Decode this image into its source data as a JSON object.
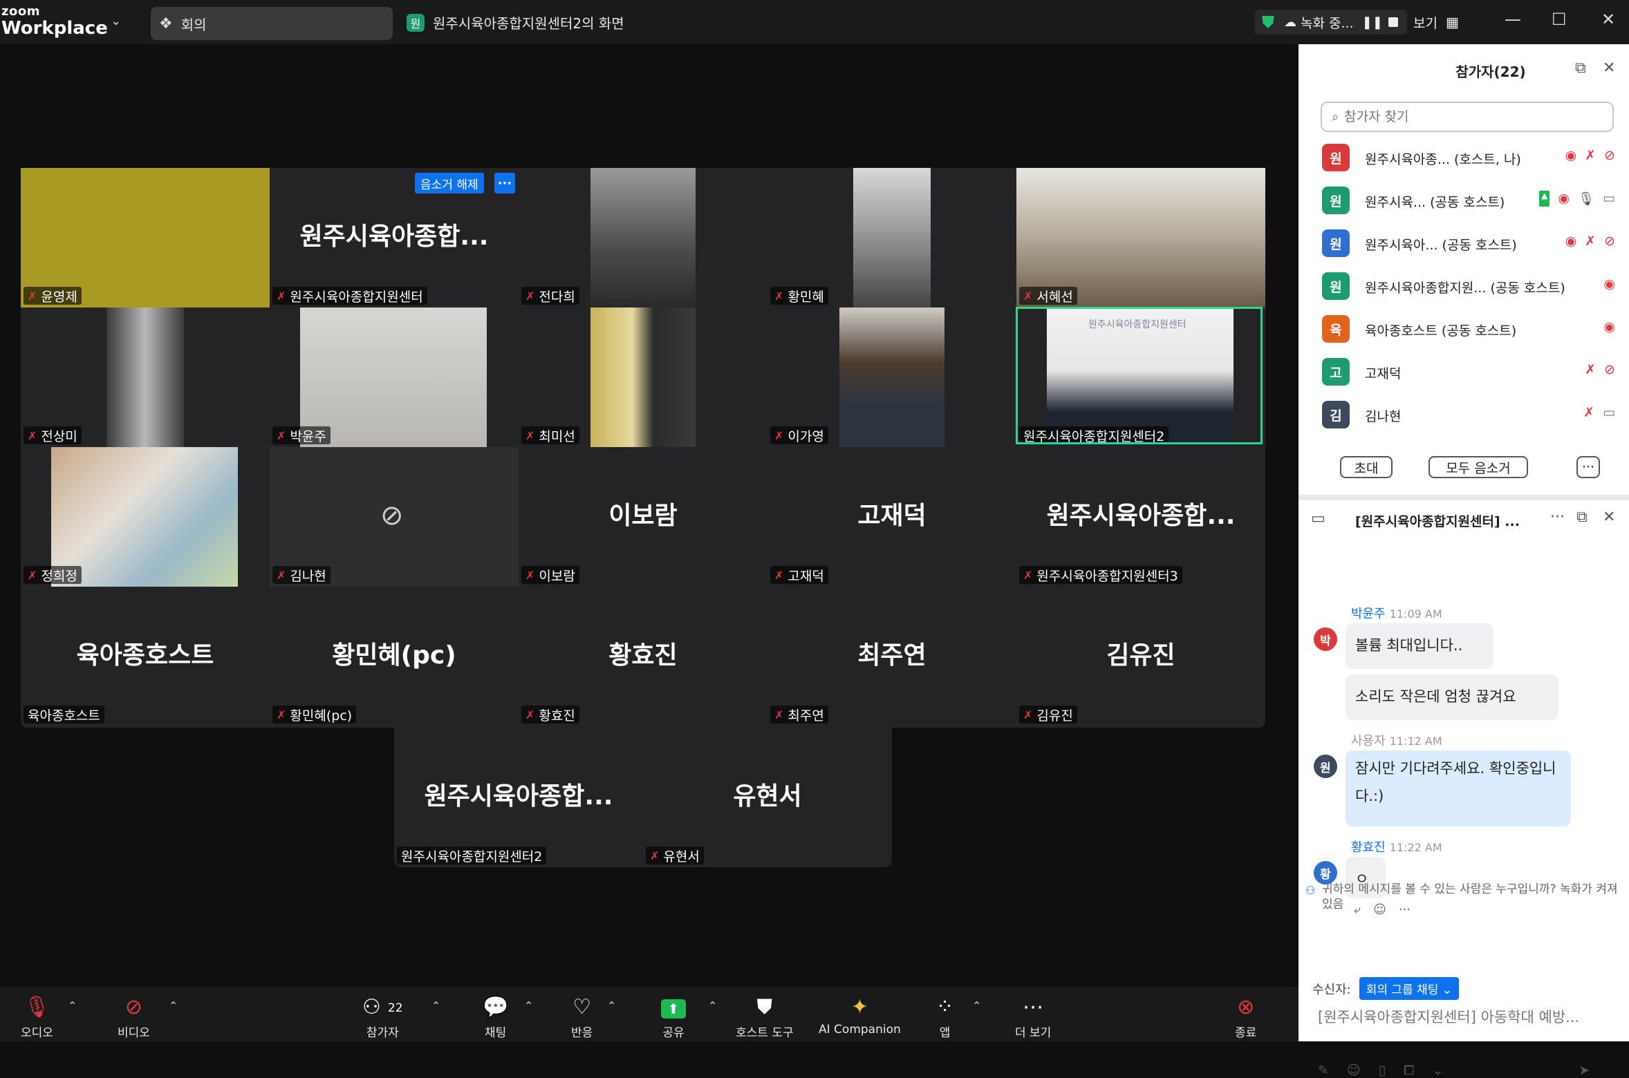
{
  "topbar": {
    "brand_line1": "zoom",
    "brand_line2": "Workplace",
    "meeting_tab": "회의",
    "share_avatar": "원",
    "share_title": "원주시육아종합지원센터2의 화면",
    "recording": "녹화 중...",
    "view": "보기"
  },
  "gallery": {
    "unmute_button": "음소거 해제",
    "more_button": "···",
    "tiles": [
      {
        "name": "윤영제",
        "big": ""
      },
      {
        "name": "원주시육아종합지원센터",
        "big": "원주시육아종합..."
      },
      {
        "name": "전다희",
        "big": ""
      },
      {
        "name": "황민혜",
        "big": ""
      },
      {
        "name": "서혜선",
        "big": ""
      },
      {
        "name": "전상미",
        "big": ""
      },
      {
        "name": "박윤주",
        "big": ""
      },
      {
        "name": "최미선",
        "big": ""
      },
      {
        "name": "이가영",
        "big": ""
      },
      {
        "name": "원주시육아종합지원센터2",
        "big": ""
      },
      {
        "name": "정희정",
        "big": ""
      },
      {
        "name": "김나현",
        "big": ""
      },
      {
        "name": "이보람",
        "big": "이보람"
      },
      {
        "name": "고재덕",
        "big": "고재덕"
      },
      {
        "name": "원주시육아종합지원센터3",
        "big": "원주시육아종합..."
      },
      {
        "name": "육아종호스트",
        "big": "육아종호스트"
      },
      {
        "name": "황민혜(pc)",
        "big": "황민혜(pc)"
      },
      {
        "name": "황효진",
        "big": "황효진"
      },
      {
        "name": "최주연",
        "big": "최주연"
      },
      {
        "name": "김유진",
        "big": "김유진"
      },
      {
        "name": "원주시육아종합지원센터2",
        "big": "원주시육아종합..."
      },
      {
        "name": "유현서",
        "big": "유현서"
      }
    ],
    "video_logo": "원주시육아종합지원센터"
  },
  "participants": {
    "title": "참가자(22)",
    "search_placeholder": "참가자 찾기",
    "list": [
      {
        "avatar": "원",
        "name": "원주시육아종...  (호스트, 나)",
        "color": "#d93b3b"
      },
      {
        "avatar": "원",
        "name": "원주시육... (공동 호스트)",
        "color": "#1e9b6f"
      },
      {
        "avatar": "원",
        "name": "원주시육아...  (공동 호스트)",
        "color": "#2f6fd0"
      },
      {
        "avatar": "원",
        "name": "원주시육아종합지원...  (공동 호스트)",
        "color": "#1e9b6f"
      },
      {
        "avatar": "육",
        "name": "육아종호스트 (공동 호스트)",
        "color": "#e0641e"
      },
      {
        "avatar": "고",
        "name": "고재덕",
        "color": "#1e9b6f"
      },
      {
        "avatar": "김",
        "name": "김나현",
        "color": "#3c4a5e"
      }
    ],
    "invite": "초대",
    "mute_all": "모두 음소거",
    "more": "···"
  },
  "chat": {
    "title": "[원주시육아종합지원센터] ...",
    "messages": [
      {
        "sender": "박윤주",
        "time": "11:09 AM",
        "avatar": "박",
        "avatar_color": "#d93b3b",
        "lines": [
          "볼륨 최대입니다..",
          "소리도 작은데 엄청 끊겨요"
        ]
      },
      {
        "sender": "사용자",
        "time": "11:12 AM",
        "avatar": "원",
        "avatar_color": "#3c4a5e",
        "lines": [
          "잠시만 기다려주세요. 확인중입니다.:)"
        ]
      },
      {
        "sender": "황효진",
        "time": "11:22 AM",
        "avatar": "황",
        "avatar_color": "#2f6fd0",
        "lines": [
          "ㅇ"
        ]
      }
    ],
    "notice": "귀하의 메시지를 볼 수 있는 사람은 누구입니까? 녹화가 켜져 있음",
    "recipient_label": "수신자:",
    "recipient_value": "회의 그룹 채팅 ⌄",
    "compose_placeholder": "[원주시육아종합지원센터] 아동학대 예방..."
  },
  "toolbar": {
    "audio": "오디오",
    "video": "비디오",
    "participants": "참가자",
    "participants_count": "22",
    "chat": "채팅",
    "reactions": "반응",
    "share": "공유",
    "host_tools": "호스트 도구",
    "ai": "AI Companion",
    "apps": "앱",
    "more": "더 보기",
    "end": "종료"
  }
}
